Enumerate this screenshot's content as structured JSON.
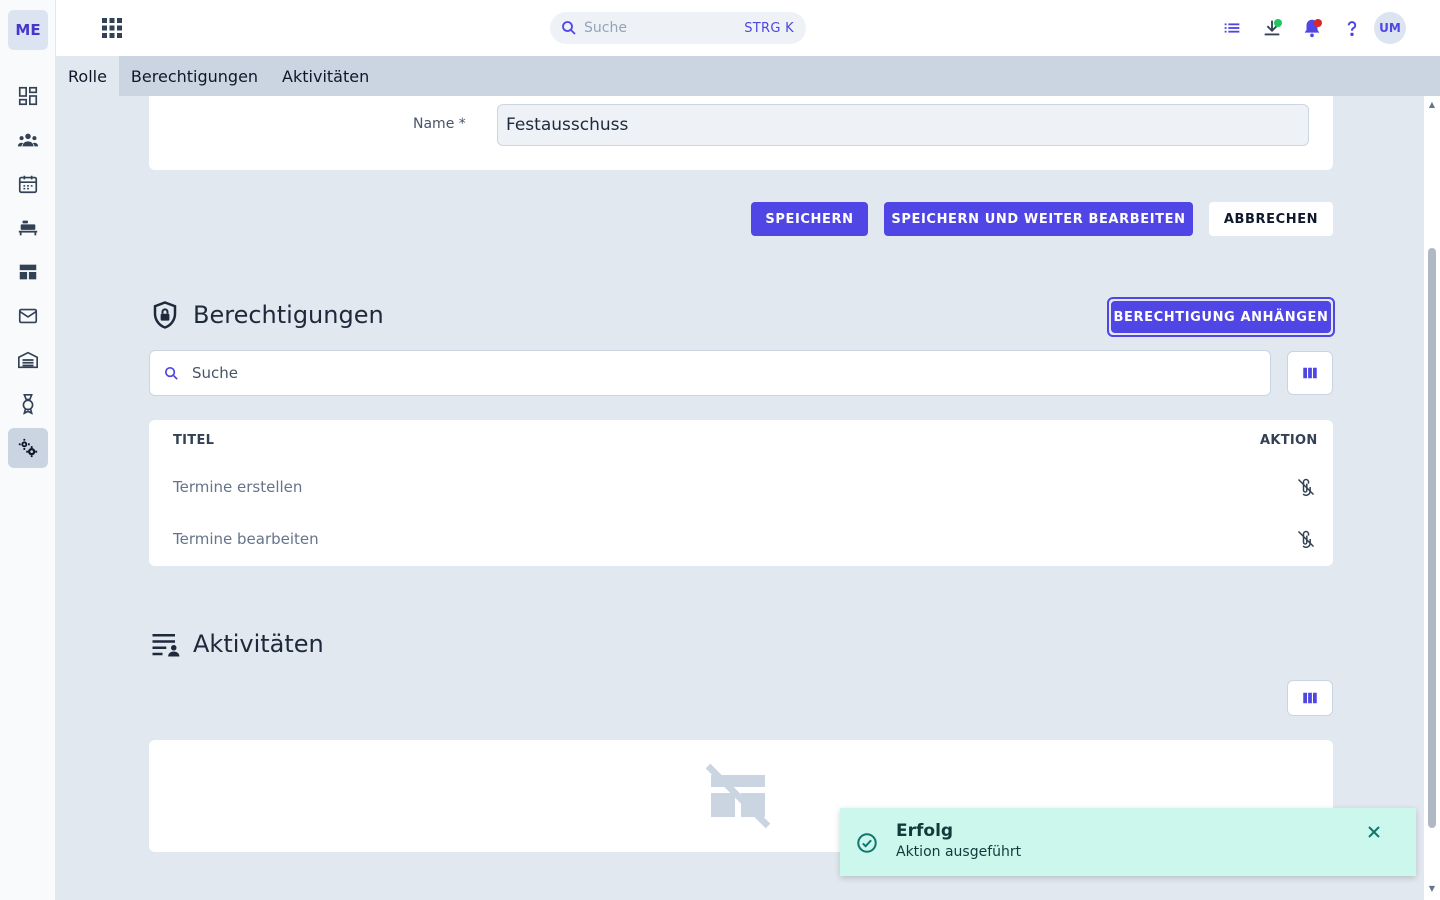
{
  "rail": {
    "logo": "ME"
  },
  "topbar": {
    "search_placeholder": "Suche",
    "search_shortcut": "STRG K",
    "avatar": "UM"
  },
  "tabs": [
    {
      "label": "Rolle"
    },
    {
      "label": "Berechtigungen"
    },
    {
      "label": "Aktivitäten"
    }
  ],
  "form": {
    "name_label": "Name *",
    "name_value": "Festausschuss"
  },
  "actions": {
    "save": "SPEICHERN",
    "save_continue": "SPEICHERN UND WEITER BEARBEITEN",
    "cancel": "ABBRECHEN"
  },
  "permissions": {
    "title": "Berechtigungen",
    "attach": "BERECHTIGUNG ANHÄNGEN",
    "search_placeholder": "Suche",
    "columns": {
      "title": "TITEL",
      "action": "AKTION"
    },
    "rows": [
      {
        "title": "Termine erstellen"
      },
      {
        "title": "Termine bearbeiten"
      }
    ]
  },
  "activities": {
    "title": "Aktivitäten"
  },
  "toast": {
    "title": "Erfolg",
    "message": "Aktion ausgeführt"
  },
  "colors": {
    "accent": "#4f46e5",
    "toast_bg": "#ccf7ec",
    "success": "#0f766e"
  },
  "icons": {
    "rail": [
      "dashboard-icon",
      "people-icon",
      "calendar-icon",
      "bed-icon",
      "table-icon",
      "mail-icon",
      "warehouse-icon",
      "badge-icon",
      "settings-icon"
    ],
    "topbar": [
      "apps-grid-icon",
      "search-icon",
      "list-icon",
      "download-icon",
      "bell-icon",
      "help-icon"
    ]
  }
}
